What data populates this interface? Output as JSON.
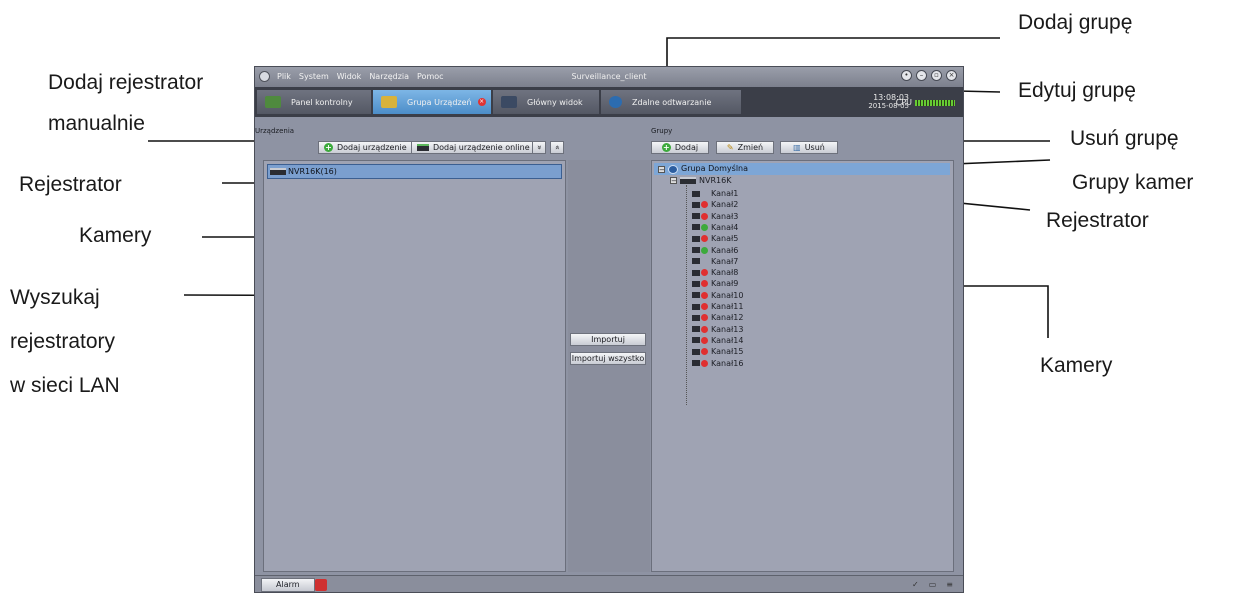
{
  "annotations": {
    "dodaj_grupe": "Dodaj grupę",
    "dodaj_rejestrator_1": "Dodaj rejestrator",
    "dodaj_rejestrator_2": "manualnie",
    "edytuj_grupe": "Edytuj grupę",
    "usun_grupe": "Usuń grupę",
    "rejestrator_left": "Rejestrator",
    "grupy_kamer": "Grupy kamer",
    "rejestrator_right": "Rejestrator",
    "kamery_left": "Kamery",
    "wyszukaj_1": "Wyszukaj",
    "wyszukaj_2": "rejestratory",
    "wyszukaj_3": "w sieci LAN",
    "kamery_right": "Kamery"
  },
  "window": {
    "title": "Surveillance_client",
    "menu": [
      "Plik",
      "System",
      "Widok",
      "Narzędzia",
      "Pomoc"
    ]
  },
  "tabs": [
    {
      "label": "Panel kontrolny",
      "icon": "monitor-icon",
      "active": false
    },
    {
      "label": "Grupa Urządzeń",
      "icon": "devices-icon",
      "active": true
    },
    {
      "label": "Główny widok",
      "icon": "screen-icon",
      "active": false
    },
    {
      "label": "Zdalne odtwarzanie",
      "icon": "playback-icon",
      "active": false
    }
  ],
  "clock": {
    "time": "13:08:03",
    "date": "2015-08-05",
    "cpu_label": "CPU"
  },
  "left": {
    "section_label": "Urządzenia",
    "add_device": "Dodaj urządzenie",
    "add_online": "Dodaj urządzenie online",
    "collapse": "»",
    "expand": "«",
    "device": "NVR16K(16)"
  },
  "middle": {
    "import": "Importuj",
    "import_all": "Importuj wszystko"
  },
  "right": {
    "section_label": "Grupy",
    "add": "Dodaj",
    "edit": "Zmień",
    "delete": "Usuń",
    "group": "Grupa Domyślna",
    "nvr": "NVR16K",
    "channels": [
      {
        "label": "Kanał1",
        "status": "idle"
      },
      {
        "label": "Kanał2",
        "status": "rec"
      },
      {
        "label": "Kanał3",
        "status": "rec"
      },
      {
        "label": "Kanał4",
        "status": "ok"
      },
      {
        "label": "Kanał5",
        "status": "rec"
      },
      {
        "label": "Kanał6",
        "status": "ok"
      },
      {
        "label": "Kanał7",
        "status": "idle"
      },
      {
        "label": "Kanał8",
        "status": "rec"
      },
      {
        "label": "Kanał9",
        "status": "rec"
      },
      {
        "label": "Kanał10",
        "status": "rec"
      },
      {
        "label": "Kanał11",
        "status": "rec"
      },
      {
        "label": "Kanał12",
        "status": "rec"
      },
      {
        "label": "Kanał13",
        "status": "rec"
      },
      {
        "label": "Kanał14",
        "status": "rec"
      },
      {
        "label": "Kanał15",
        "status": "rec"
      },
      {
        "label": "Kanał16",
        "status": "rec"
      }
    ]
  },
  "statusbar": {
    "alarm": "Alarm"
  },
  "colors": {
    "active_tab": "#4c8dc8",
    "selection": "#7b9fcf",
    "rec": "#e03030",
    "ok": "#3caa3c"
  }
}
